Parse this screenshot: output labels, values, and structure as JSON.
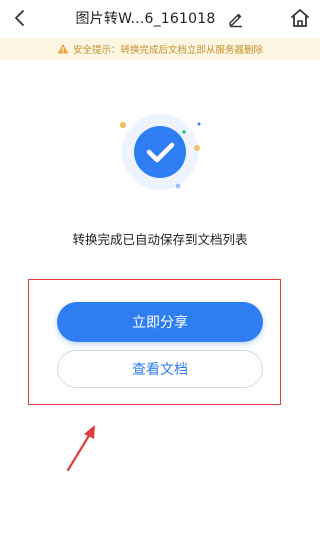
{
  "header": {
    "title": "图片转W...6_161018",
    "back_icon": "back-chevron-icon",
    "edit_icon": "pencil-icon",
    "home_icon": "home-icon"
  },
  "notice": {
    "text": "安全提示：转换完成后文档立即从服务器删除",
    "icon": "warning-icon",
    "color": "#c58d2a",
    "background": "#fdf6e3"
  },
  "result": {
    "icon": "check-circle-icon",
    "message": "转换完成已自动保存到文档列表"
  },
  "actions": {
    "share_label": "立即分享",
    "view_label": "查看文档"
  },
  "colors": {
    "accent": "#2f7df3",
    "annotation": "#e23b3b"
  }
}
